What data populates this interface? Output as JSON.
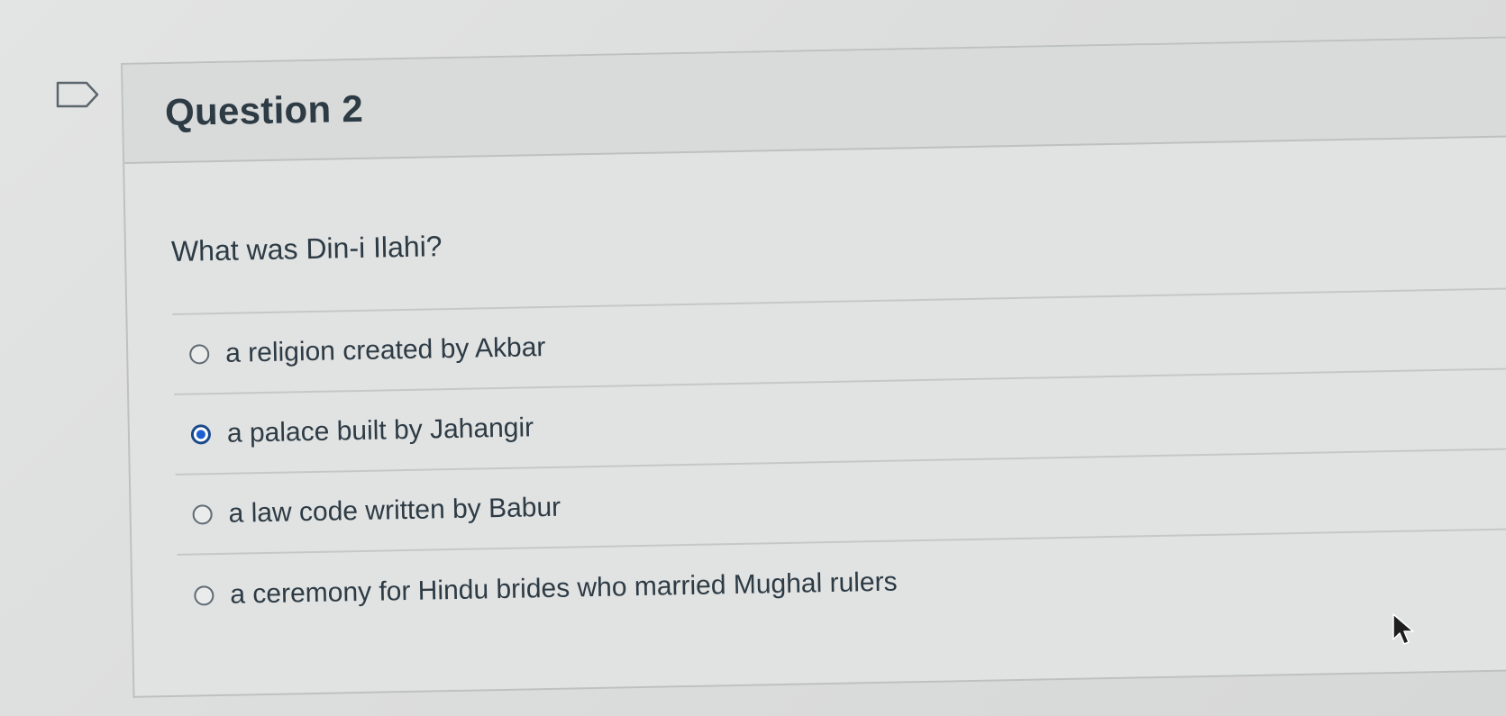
{
  "question": {
    "title": "Question 2",
    "text": "What was Din-i Ilahi?",
    "answers": [
      {
        "label": "a religion created by Akbar",
        "selected": false
      },
      {
        "label": "a palace built by Jahangir",
        "selected": true
      },
      {
        "label": "a law code written by Babur",
        "selected": false
      },
      {
        "label": "a ceremony for Hindu brides who married Mughal rulers",
        "selected": false
      }
    ]
  },
  "colors": {
    "selected_radio": "#1b5fd1",
    "text": "#2d3b45"
  },
  "icons": {
    "flag": "flag-icon",
    "cursor": "mouse-pointer-icon"
  }
}
